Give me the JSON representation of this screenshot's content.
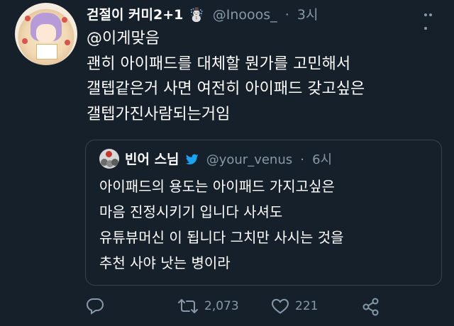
{
  "tweet": {
    "author_name": "걷절이 커미2+1 ☃️",
    "handle": "@Inooos_",
    "time": "3시",
    "lines": [
      "@이게맞음",
      "괜히 아이패드를 대체할 뭔가를 고민해서",
      "갤텝같은거 사면 여전히 아이패드 갖고싶은",
      "갤텝가진사람되는거임"
    ]
  },
  "quoted": {
    "author_name": "빈어 스님",
    "handle": "@your_venus",
    "time": "6시",
    "lines": [
      "아이패드의 용도는 아이패드 가지고싶은",
      "마음 진정시키기 입니다 사셔도",
      "유튜뷰머신 이 됩니다 그치만 사시는 것을",
      "추천 사야 낫는 병이라"
    ]
  },
  "actions": {
    "retweet_count": "2,073",
    "like_count": "221",
    "icons": [
      "reply-icon",
      "retweet-icon",
      "like-icon",
      "share-icon"
    ]
  },
  "colors": {
    "background": "#15202b",
    "secondary_text": "#8899a6",
    "border": "#38444d"
  }
}
